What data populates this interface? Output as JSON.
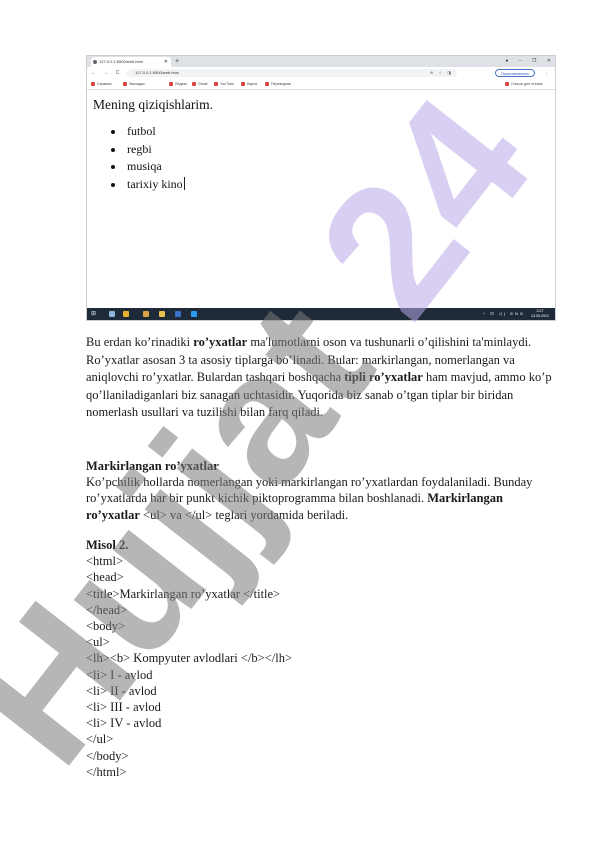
{
  "browser": {
    "tab_title": "127.0.0.1:5500/web.html",
    "new_tab": "+",
    "window_controls": [
      "●",
      "–",
      "❐",
      "✕"
    ],
    "nav": "← → C ⌂",
    "address": "127.0.0.1:5500/web.html",
    "omnibox_icons": "⊕ ☆ ◨",
    "profile_button": "Приостановлено",
    "menu": "⋮",
    "bookmarks": [
      {
        "label": "Сервисы"
      },
      {
        "label": "Закладки"
      },
      {
        "label": "Яндекс"
      },
      {
        "label": "Gmail"
      },
      {
        "label": "YouTube"
      },
      {
        "label": "Карты"
      },
      {
        "label": "Переводчик"
      }
    ],
    "reading_list": "Список для чтения"
  },
  "web_page": {
    "title": "Mening qiziqishlarim.",
    "items": [
      "futbol",
      "regbi",
      "musiqa",
      "tarixiy kino"
    ]
  },
  "taskbar": {
    "start": "⊞",
    "tray": "^ ⊡ ◁) ENG",
    "time": "3:27",
    "date": "13.05.2021"
  },
  "doc": {
    "p1": {
      "a": "Bu erdan ko’rinadiki ",
      "b": "ro’yxatlar",
      "c": " ma'lumotlarni oson va tushunarli o’qilishini ta'minlaydi. Ro’yxatlar asosan 3 ta asosiy tiplarga bo’linadi. Bular: markirlangan, nomerlangan va aniqlovchi ro’yxatlar. Bulardan tashqari boshqacha ",
      "d": "tipli ro’yxatlar",
      "e": " ham mavjud, ammo ko’p qo’llaniladiganlari biz sanagan uchtasidir. Yuqorida biz sanab o’tgan tiplar bir biridan nomerlash usullari va tuzilishi bilan farq qiladi."
    },
    "p2": {
      "heading": "Markirlangan ro’yxatlar",
      "a": "Ko’pchilik hollarda nomerlangan yoki markirlangan ro’yxatlardan foydalaniladi. Bunday ro’yxatlarda har bir punkt kichik piktoprogramma bilan boshlanadi. ",
      "b": "Markirlangan ro’yxatlar",
      "c": " <ul> va </ul> teglari yordamida beriladi."
    },
    "example": {
      "heading": "Misol 2.",
      "lines": [
        "<html>",
        "<head>",
        "<title>Markirlangan ro’yxatlar </title>",
        "</head>",
        "<body>",
        "<ul>",
        "<lh><b> Kompyuter avlodlari </b></lh>",
        "<li> I - avlod",
        "<li> II - avlod",
        "<li> III - avlod",
        "<li> IV - avlod",
        "</ul>",
        "</body>",
        "</html>"
      ]
    }
  },
  "watermark": "Hujjat 24",
  "colors": {
    "watermark": "#b8a8e8",
    "watermark_shadow": "#7a7a7a",
    "taskbar": "#1e2a38"
  }
}
